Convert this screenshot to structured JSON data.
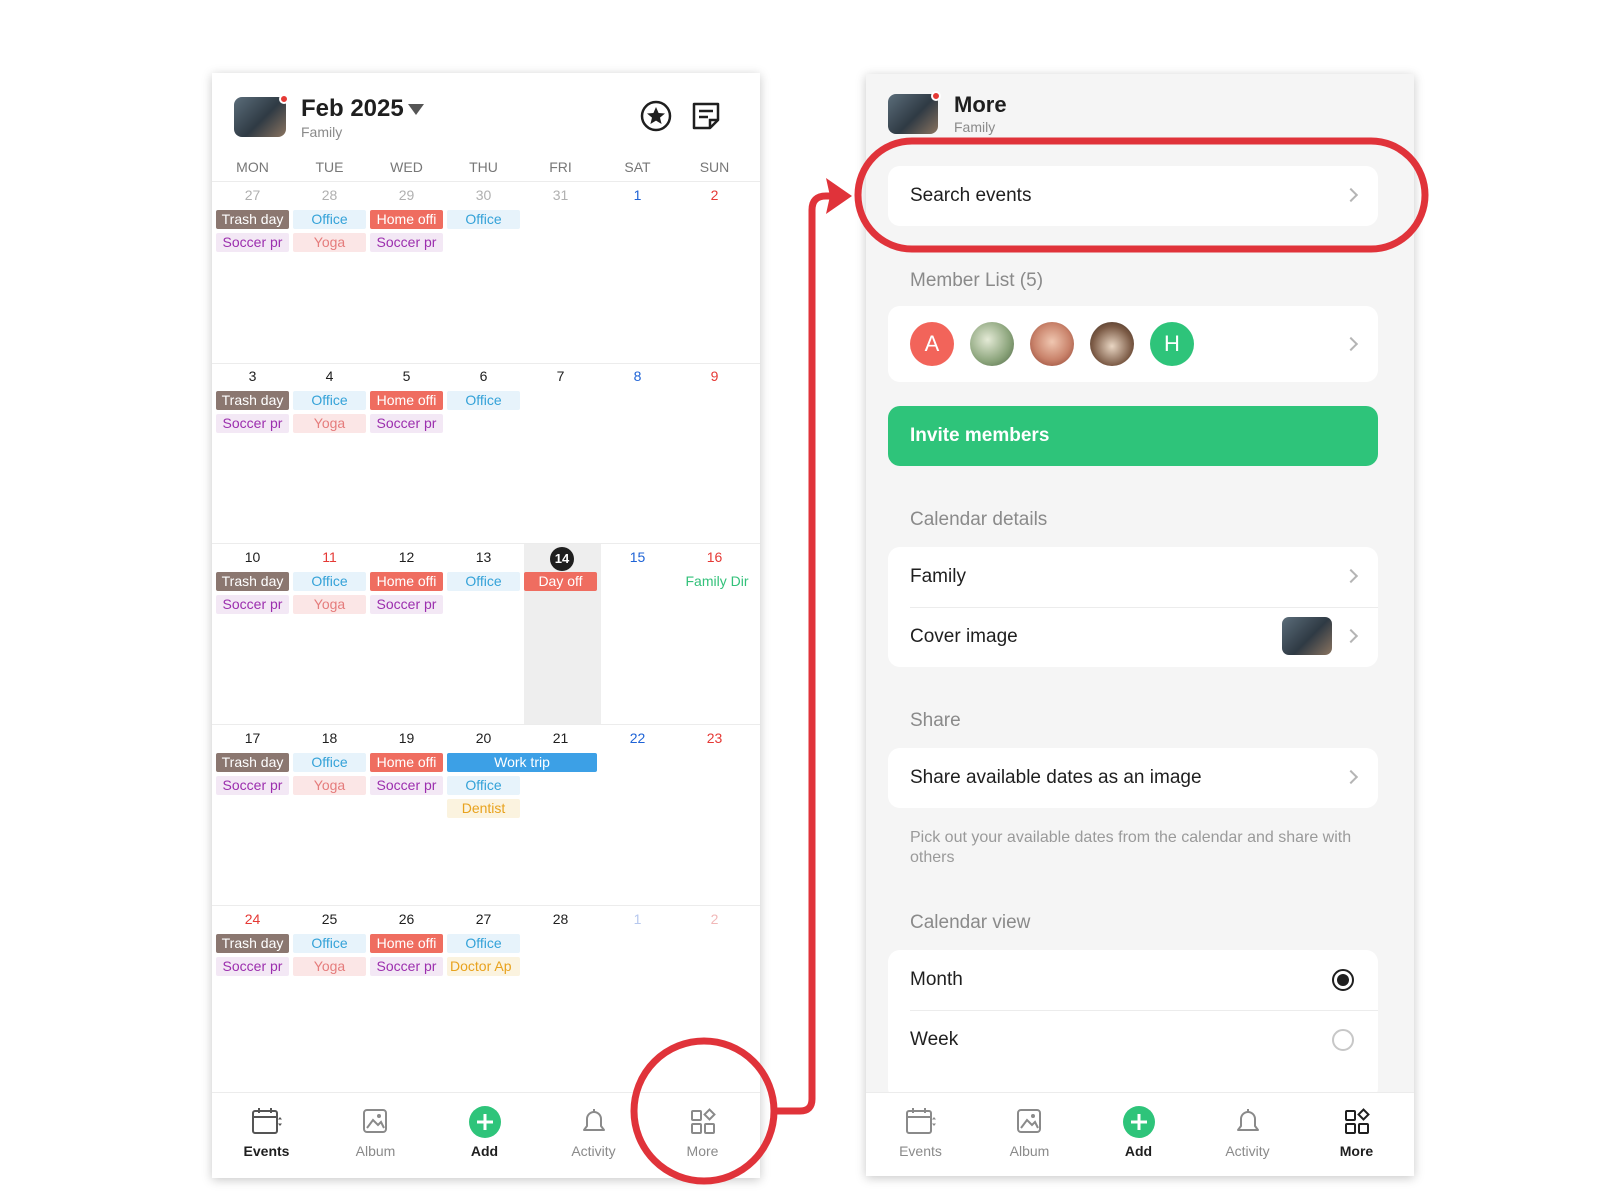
{
  "left": {
    "header": {
      "title": "Feb 2025",
      "subtitle": "Family"
    },
    "weekdays": [
      "MON",
      "TUE",
      "WED",
      "THU",
      "FRI",
      "SAT",
      "SUN"
    ],
    "weeks": [
      [
        "27",
        "28",
        "29",
        "30",
        "31",
        "1",
        "2"
      ],
      [
        "3",
        "4",
        "5",
        "6",
        "7",
        "8",
        "9"
      ],
      [
        "10",
        "11",
        "12",
        "13",
        "14",
        "15",
        "16"
      ],
      [
        "17",
        "18",
        "19",
        "20",
        "21",
        "22",
        "23"
      ],
      [
        "24",
        "25",
        "26",
        "27",
        "28",
        "1",
        "2"
      ]
    ],
    "events": {
      "trash": "Trash day",
      "office": "Office",
      "home": "Home offi",
      "soccer": "Soccer pr",
      "yoga": "Yoga",
      "day_off": "Day off",
      "family_dinner": "Family Dir",
      "work_trip": "Work trip",
      "dentist": "Dentist",
      "doctor": "Doctor Ap"
    },
    "tabs": [
      "Events",
      "Album",
      "Add",
      "Activity",
      "More"
    ]
  },
  "right": {
    "header": {
      "title": "More",
      "subtitle": "Family"
    },
    "search_label": "Search events",
    "member_list_label": "Member List (5)",
    "members": [
      {
        "initial": "A",
        "color": "#f2645a"
      },
      {
        "initial": "",
        "color": "#8aa37a"
      },
      {
        "initial": "",
        "color": "#c9836b"
      },
      {
        "initial": "",
        "color": "#7b5a45"
      },
      {
        "initial": "H",
        "color": "#2ec47a"
      }
    ],
    "invite_label": "Invite members",
    "calendar_details_label": "Calendar details",
    "family_label": "Family",
    "cover_image_label": "Cover image",
    "share_label": "Share",
    "share_dates_label": "Share available dates as an image",
    "share_note": "Pick out your available dates from the calendar and share with others",
    "calendar_view_label": "Calendar view",
    "month_label": "Month",
    "week_label": "Week",
    "tabs": [
      "Events",
      "Album",
      "Add",
      "Activity",
      "More"
    ]
  },
  "colors": {
    "accent_green": "#2ec47a",
    "annotation_red": "#e0333a",
    "sunday_red": "#e53935",
    "saturday_blue": "#1e63d6"
  }
}
